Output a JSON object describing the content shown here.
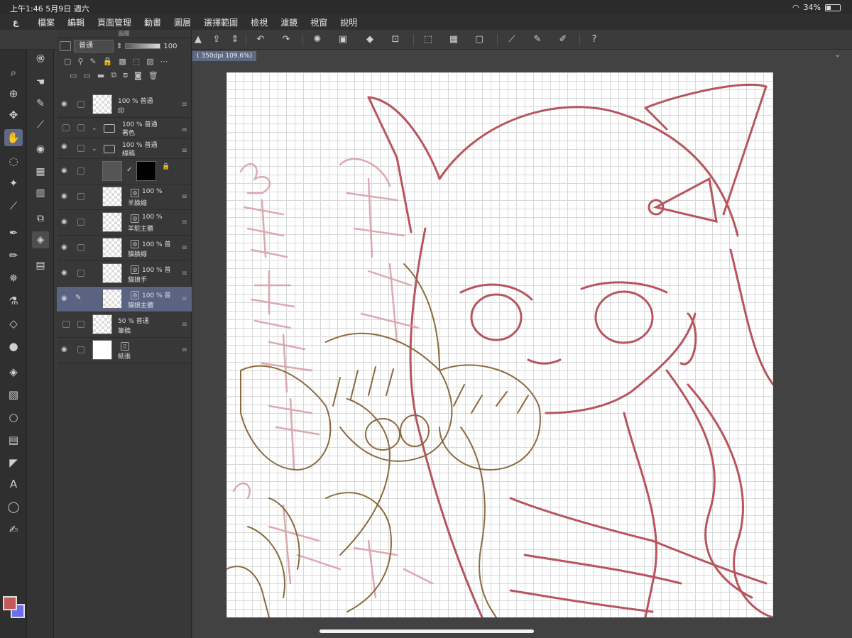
{
  "status": {
    "time": "上午1:46 5月9日 週六",
    "battery": "34%"
  },
  "menu": [
    "檔案",
    "編輯",
    "頁面管理",
    "動畫",
    "圖層",
    "選擇範圍",
    "檢視",
    "濾鏡",
    "視窗",
    "說明"
  ],
  "canvas_tab": "( 350dpi 109.6%)",
  "layer_panel": {
    "title": "圖層",
    "blend_mode": "普通",
    "opacity": "100",
    "layers": [
      {
        "pct": "100 % 普通",
        "name": "印"
      },
      {
        "pct": "100 % 普通",
        "name": "著色"
      },
      {
        "pct": "100 % 普通",
        "name": "線稿"
      },
      {
        "pct": "",
        "name": ""
      },
      {
        "pct": "100 %",
        "name": "羊臉線"
      },
      {
        "pct": "100 %",
        "name": "羊駝主體"
      },
      {
        "pct": "100 % 普",
        "name": "貓臉線"
      },
      {
        "pct": "100 % 普",
        "name": "貓娘手"
      },
      {
        "pct": "100 % 普",
        "name": "貓娘主體"
      },
      {
        "pct": "50 % 普通",
        "name": "筆稿"
      },
      {
        "pct": "",
        "name": "紙張"
      }
    ]
  },
  "colors": {
    "main": "#c35a5a",
    "sub": "#6c6ef0",
    "accent": "#5d6a86",
    "sketch_red": "#b8545e",
    "sketch_brown": "#8b6a3e"
  }
}
